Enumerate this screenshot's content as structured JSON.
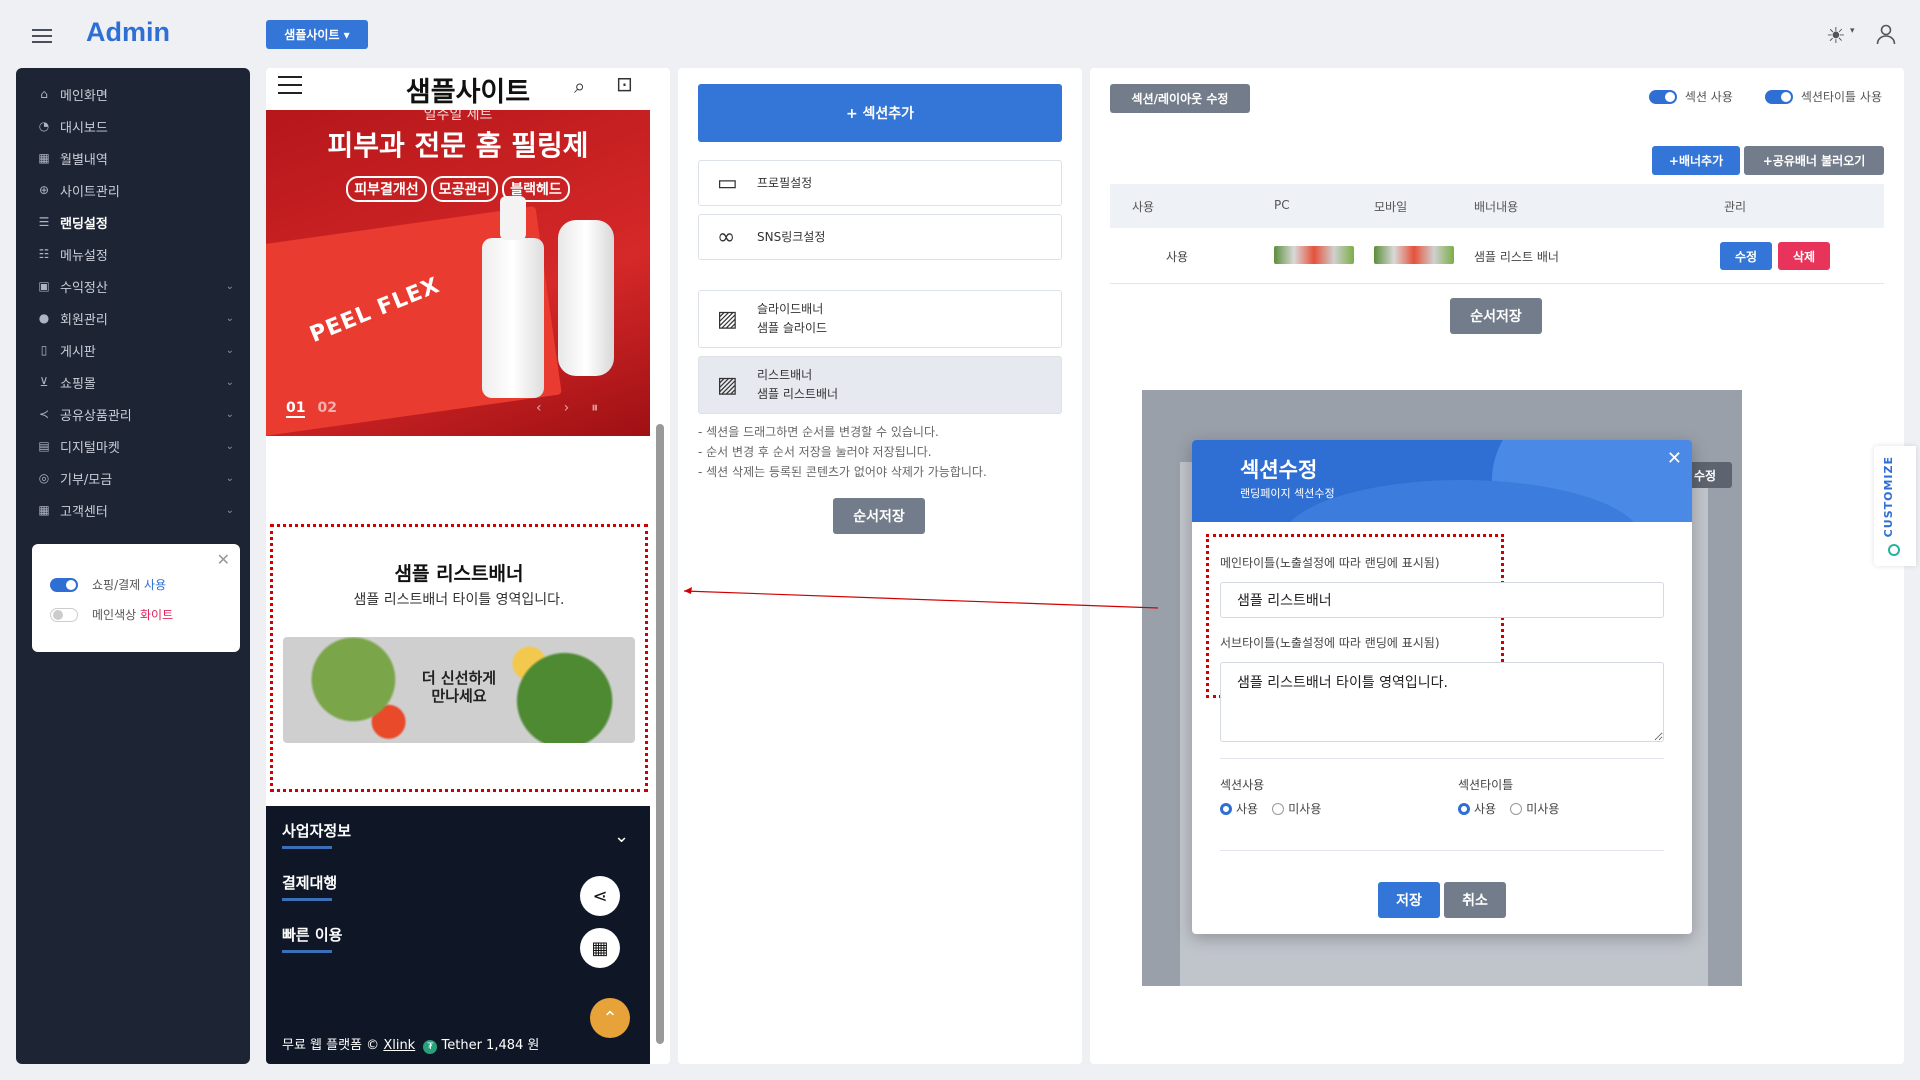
{
  "header": {
    "brand": "Admin",
    "site_dropdown": "샘플사이트 ▾"
  },
  "sidebar": {
    "items": [
      {
        "icon": "home-icon",
        "label": "메인화면"
      },
      {
        "icon": "dashboard-icon",
        "label": "대시보드"
      },
      {
        "icon": "calendar-icon",
        "label": "월별내역"
      },
      {
        "icon": "globe-icon",
        "label": "사이트관리"
      },
      {
        "icon": "list-icon",
        "label": "랜딩설정",
        "active": true
      },
      {
        "icon": "menu-list-icon",
        "label": "메뉴설정"
      },
      {
        "icon": "lock-icon",
        "label": "수익정산",
        "chevron": true
      },
      {
        "icon": "user-icon",
        "label": "회원관리",
        "chevron": true
      },
      {
        "icon": "clipboard-icon",
        "label": "게시판",
        "chevron": true
      },
      {
        "icon": "cart-icon",
        "label": "쇼핑몰",
        "chevron": true
      },
      {
        "icon": "share-icon",
        "label": "공유상품관리",
        "chevron": true
      },
      {
        "icon": "document-icon",
        "label": "디지털마켓",
        "chevron": true
      },
      {
        "icon": "coins-icon",
        "label": "기부/모금",
        "chevron": true
      },
      {
        "icon": "calendar-icon",
        "label": "고객센터",
        "chevron": true
      }
    ],
    "options": {
      "shop_pay_prefix": "쇼핑/결제",
      "shop_pay_value": "사용",
      "main_color_prefix": "메인색상",
      "main_color_value": "화이트"
    }
  },
  "preview": {
    "site_title": "샘플사이트",
    "hero": {
      "top_text": "일주일 세트",
      "title": "피부과 전문 홈 필링제",
      "tags": [
        "피부결개선",
        "모공관리",
        "블랙헤드"
      ],
      "box_text": "PEEL FLEX",
      "slide_current": "01",
      "slide_next": "02"
    },
    "list_banner": {
      "title": "샘플 리스트배너",
      "subtitle": "샘플 리스트배너 타이틀 영역입니다.",
      "image_text_line1": "더 신선하게",
      "image_text_line2": "만나세요"
    },
    "footer": {
      "items": [
        "사업자정보",
        "결제대행",
        "빠른 이용"
      ],
      "copyright_prefix": "무료 웹 플랫폼 ©",
      "copyright_link": "Xlink",
      "tether": "Tether 1,484 원"
    }
  },
  "sections": {
    "add_button": "+ 섹션추가",
    "items": [
      {
        "icon": "profile-card-icon",
        "line1": "프로필설정",
        "line2": ""
      },
      {
        "icon": "link-icon",
        "line1": "SNS링크설정",
        "line2": ""
      },
      {
        "icon": "gallery-icon",
        "line1": "슬라이드배너",
        "line2": "샘플 슬라이드"
      },
      {
        "icon": "image-icon",
        "line1": "리스트배너",
        "line2": "샘플 리스트배너",
        "selected": true
      }
    ],
    "help": [
      "- 섹션을 드래그하면 순서를 변경할 수 있습니다.",
      "- 순서 변경 후 순서 저장을 눌러야 저장됩니다.",
      "- 섹션 삭제는 등록된 콘텐츠가 없어야 삭제가 가능합니다."
    ],
    "save_order": "순서저장"
  },
  "editor": {
    "badge": "섹션/레이아웃 수정",
    "toggle_section": "섹션 사용",
    "toggle_title": "섹션타이틀 사용",
    "add_banner": "+배너추가",
    "load_shared": "+공유배너 불러오기",
    "columns": [
      "사용",
      "PC",
      "모바일",
      "배너내용",
      "관리"
    ],
    "rows": [
      {
        "use": "사용",
        "content": "샘플 리스트 배너",
        "edit": "수정",
        "delete": "삭제"
      }
    ],
    "save_order": "순서저장",
    "behind_badge": "수정"
  },
  "modal": {
    "title": "섹션수정",
    "subtitle": "랜딩페이지 섹션수정",
    "main_title_label": "메인타이틀(노출설정에 따라 랜딩에 표시됨)",
    "main_title_value": "샘플 리스트배너",
    "sub_title_label": "서브타이틀(노출설정에 따라 랜딩에 표시됨)",
    "sub_title_value": "샘플 리스트배너 타이틀 영역입니다.",
    "section_use_label": "섹션사용",
    "section_title_label": "섹션타이틀",
    "opt_use": "사용",
    "opt_unused": "미사용",
    "save": "저장",
    "cancel": "취소"
  },
  "customize_tab": "CUSTOMIZE",
  "colors": {
    "primary": "#2f6fd4",
    "sidebar_bg": "#1d2433",
    "danger": "#e8335a",
    "gray_button": "#737c8a"
  }
}
